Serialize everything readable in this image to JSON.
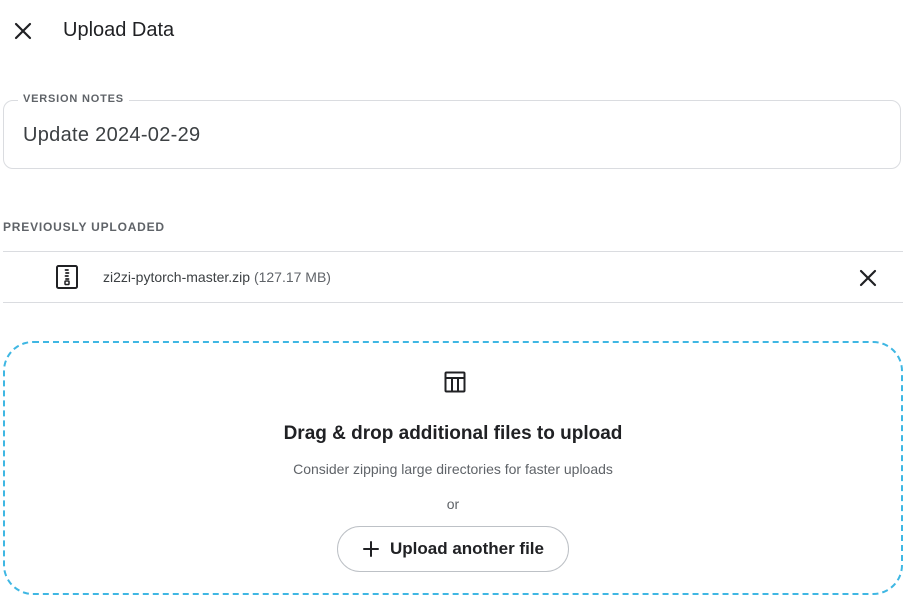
{
  "header": {
    "title": "Upload Data",
    "close_icon": "close-icon"
  },
  "version_notes": {
    "label": "VERSION NOTES",
    "value": "Update 2024-02-29"
  },
  "previously_uploaded": {
    "label": "PREVIOUSLY UPLOADED",
    "files": [
      {
        "icon": "zip-file-icon",
        "name": "zi2zi-pytorch-master.zip",
        "size": "(127.17 MB)",
        "remove_icon": "close-icon"
      }
    ]
  },
  "dropzone": {
    "icon": "table-icon",
    "title": "Drag & drop additional files to upload",
    "subtitle": "Consider zipping large directories for faster uploads",
    "or_text": "or",
    "button_label": "Upload another file",
    "button_icon": "plus-icon",
    "border_color": "#3fb7e3"
  }
}
